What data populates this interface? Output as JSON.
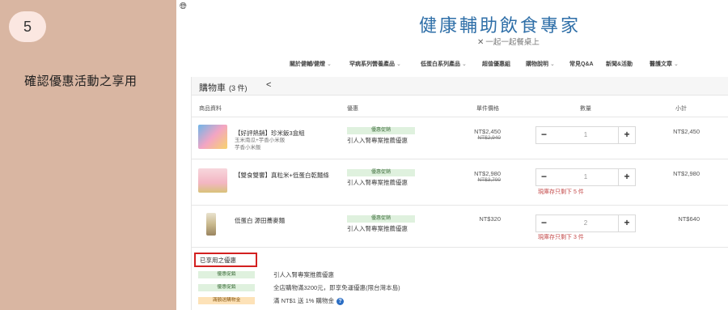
{
  "step": {
    "number": "5",
    "caption": "確認優惠活動之享用"
  },
  "brand": {
    "globe_icon": "globe-icon",
    "title": "健康輔助飲食專家",
    "subtitle_icon": "fork-spoon-icon",
    "subtitle": "一起一起餐桌上"
  },
  "nav": [
    {
      "label": "關於健輔/健燈",
      "has_dropdown": true
    },
    {
      "label": "罕病系列營養產品",
      "has_dropdown": true
    },
    {
      "label": "低蛋白系列產品",
      "has_dropdown": true
    },
    {
      "label": "超值優惠組",
      "has_dropdown": false
    },
    {
      "label": "購物說明",
      "has_dropdown": true
    },
    {
      "label": "常見Q&A",
      "has_dropdown": false
    },
    {
      "label": "新聞&活動",
      "has_dropdown": false
    },
    {
      "label": "醫護文章",
      "has_dropdown": true
    }
  ],
  "cart": {
    "title": "購物車",
    "count": "(3 件)",
    "share_icon": "share-icon",
    "columns": {
      "product": "商品資料",
      "promo": "優惠",
      "unit_price": "單件價格",
      "quantity": "數量",
      "subtotal": "小計"
    },
    "items": [
      {
        "name": "【好評熱銷】珍米飯3盒組",
        "variant_line1": "玉米南瓜+芋香小米飯",
        "variant_line2": "芋香小米飯",
        "promo_tag": "優惠促銷",
        "promo_text": "引人入腎專案推薦優惠",
        "price": "NT$2,450",
        "original_price": "NT$2,940",
        "quantity": "1",
        "stock_note": "",
        "subtotal": "NT$2,450"
      },
      {
        "name": "【雙食雙饗】真粒米+低蛋白乾麵條",
        "variant_line1": "",
        "variant_line2": "",
        "promo_tag": "優惠促銷",
        "promo_text": "引人入腎專案推薦優惠",
        "price": "NT$2,980",
        "original_price": "NT$3,700",
        "quantity": "1",
        "stock_note": "現庫存只剩下 5 件",
        "subtotal": "NT$2,980"
      },
      {
        "name": "低蛋白 源田蕎麥麵",
        "variant_line1": "",
        "variant_line2": "",
        "promo_tag": "優惠促銷",
        "promo_text": "引人入腎專案推薦優惠",
        "price": "NT$320",
        "original_price": "",
        "quantity": "2",
        "stock_note": "現庫存只剩下 3 件",
        "subtotal": "NT$640"
      }
    ],
    "qty_minus": "−",
    "qty_plus": "+"
  },
  "applied": {
    "title": "已享用之優惠",
    "items": [
      {
        "tag": "優惠促銷",
        "text": "引人入腎專案推薦優惠",
        "tag_color": "#dff1de"
      },
      {
        "tag": "優惠促銷",
        "text": "全店購物滿3200元，即享免運優惠(限台灣本島)",
        "tag_color": "#dff1de"
      },
      {
        "tag": "滿額送購物金",
        "text": "滿 NT$1 送 1% 購物金",
        "tag_color": "#fde2b8",
        "help_icon": "question-circle-icon"
      }
    ]
  },
  "colors": {
    "left_panel": "#d9b6a2",
    "brand_blue": "#2f6fa8",
    "highlight_red": "#d32020",
    "stock_red": "#c44b4b"
  }
}
